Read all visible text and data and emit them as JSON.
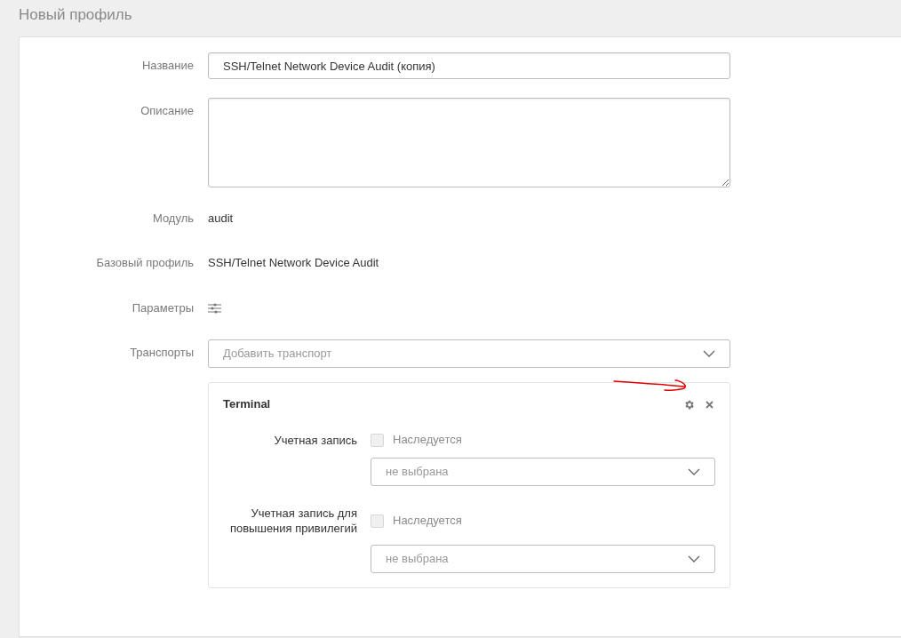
{
  "page_title": "Новый профиль",
  "form": {
    "name": {
      "label": "Название",
      "value": "SSH/Telnet Network Device Audit (копия)"
    },
    "description": {
      "label": "Описание"
    },
    "module": {
      "label": "Модуль",
      "value": "audit"
    },
    "base_profile": {
      "label": "Базовый профиль",
      "value": "SSH/Telnet Network Device Audit"
    },
    "parameters": {
      "label": "Параметры"
    },
    "transports": {
      "label": "Транспорты",
      "placeholder": "Добавить транспорт"
    }
  },
  "transport_cards": [
    {
      "title": "Terminal",
      "fields": [
        {
          "label": "Учетная запись",
          "checkbox_label": "Наследуется",
          "checked": false,
          "disabled": true,
          "placeholder": "не выбрана"
        },
        {
          "label": "Учетная запись для повышения привилегий",
          "checkbox_label": "Наследуется",
          "checked": false,
          "disabled": true,
          "placeholder": "не выбрана"
        }
      ]
    }
  ]
}
